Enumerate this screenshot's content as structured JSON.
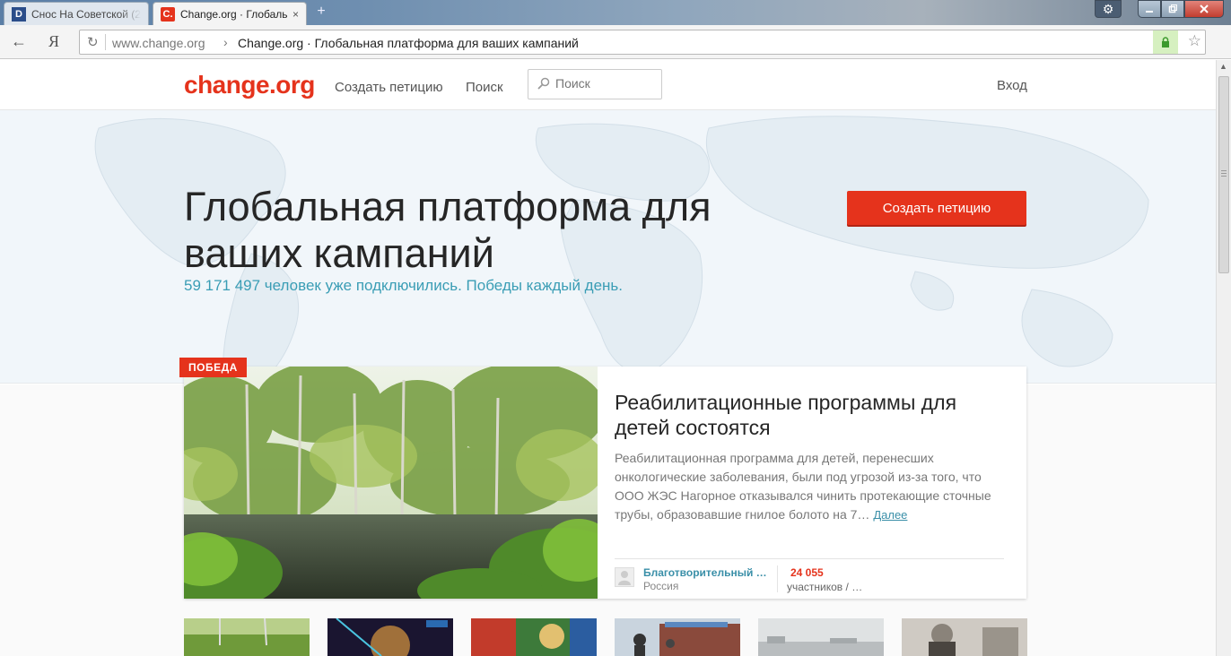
{
  "browser": {
    "tabs": [
      {
        "favicon": "D",
        "title": "Снос На Советской (2"
      },
      {
        "favicon": "C.",
        "title": "Change.org · Глобаль",
        "close": "×"
      }
    ],
    "new_tab": "+",
    "back": "←",
    "yandex": "Я",
    "url_domain": "www.change.org",
    "url_sep": "›",
    "url_title": "Change.org · Глобальная платформа для ваших кампаний"
  },
  "header": {
    "logo": "change.org",
    "create_link": "Создать петицию",
    "search_link": "Поиск",
    "search_placeholder": "Поиск",
    "login": "Вход"
  },
  "hero": {
    "title": "Глобальная платформа для ваших кампаний",
    "subtitle": "59 171 497 человек уже подключились. Победы каждый день.",
    "cta": "Создать петицию"
  },
  "featured": {
    "badge": "ПОБЕДА",
    "title": "Реабилитационные программы для детей состоятся",
    "description": "Реабилитационная программа для детей, перенесших онкологические заболевания, были под угрозой из-за того, что ООО ЖЭС Нагорное отказывался чинить протекающие сточные трубы, образовавшие гнилое болото на 7…",
    "more": "Далее",
    "org": "Благотворительный …",
    "country": "Россия",
    "count": "24 055",
    "count_label": "участников / …"
  },
  "colors": {
    "brand": "#e5331c",
    "accent": "#3a9db5"
  }
}
